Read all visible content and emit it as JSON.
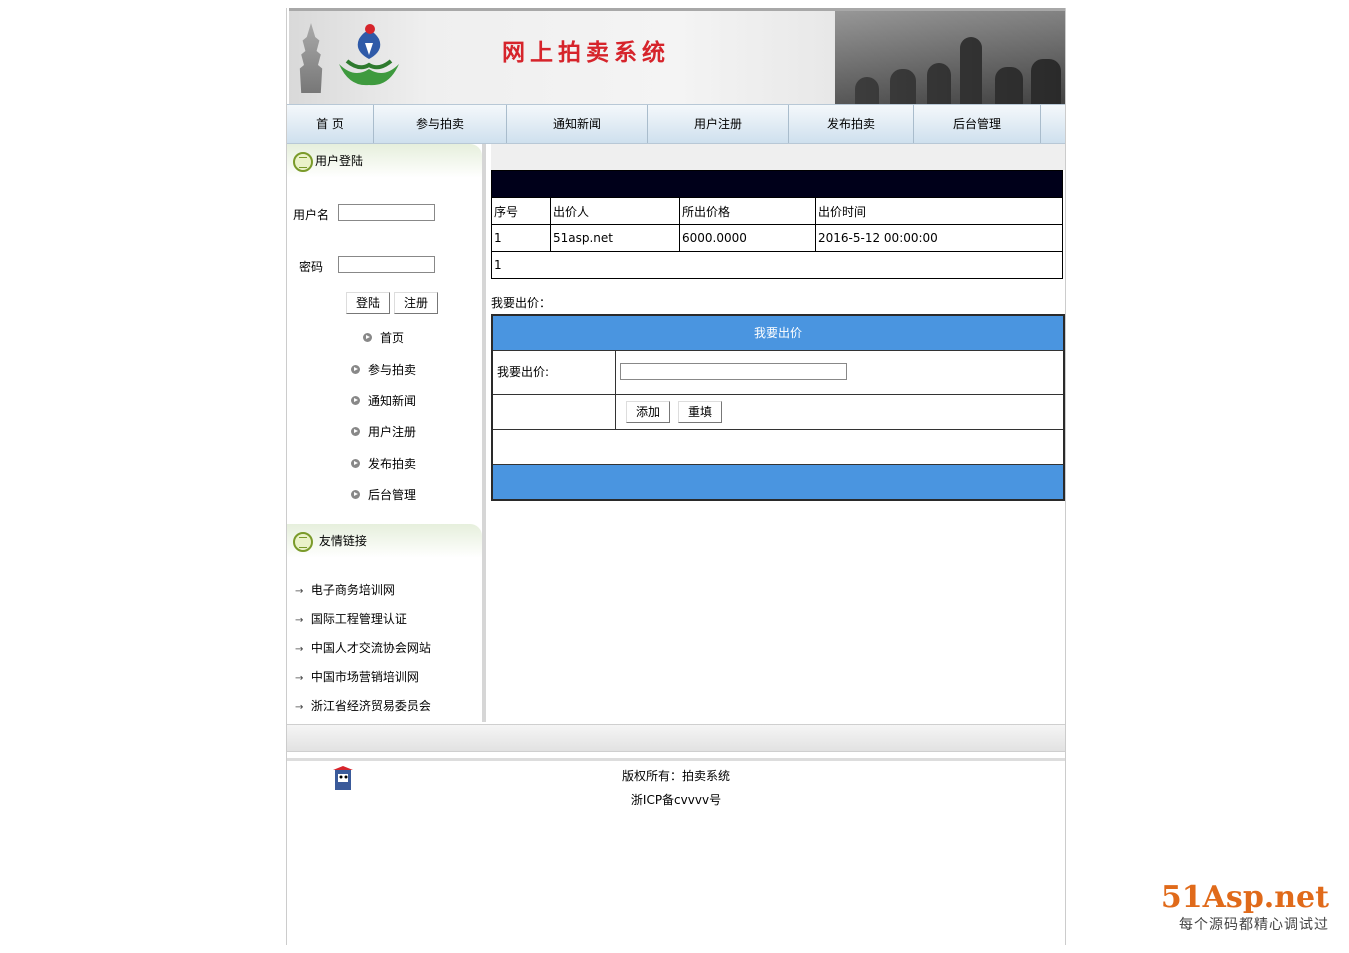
{
  "site_title": "网上拍卖系统",
  "nav": [
    "首 页",
    "参与拍卖",
    "通知新闻",
    "用户注册",
    "发布拍卖",
    "后台管理"
  ],
  "login": {
    "heading": "用户登陆",
    "username_label": "用户名",
    "password_label": "密码",
    "login_button": "登陆",
    "register_button": "注册"
  },
  "side_menu": [
    "首页",
    "参与拍卖",
    "通知新闻",
    "用户注册",
    "发布拍卖",
    "后台管理"
  ],
  "links": {
    "heading": "友情链接",
    "items": [
      "电子商务培训网",
      "国际工程管理认证",
      "中国人才交流协会网站",
      "中国市场营销培训网",
      "浙江省经济贸易委员会"
    ]
  },
  "bids": {
    "columns": [
      "序号",
      "出价人",
      "所出价格",
      "出价时间"
    ],
    "rows": [
      [
        "1",
        "51asp.net",
        "6000.0000",
        "2016-5-12 00:00:00"
      ]
    ],
    "pager": "1"
  },
  "bid_form": {
    "section_label": "我要出价：",
    "header": "我要出价",
    "price_label": "我要出价:",
    "price_value": "",
    "add_button": "添加",
    "reset_button": "重填"
  },
  "footer": {
    "copyright": "版权所有：拍卖系统",
    "icp": "浙ICP备cvvvv号"
  },
  "watermark": {
    "brand": "51Asp.net",
    "slogan": "每个源码都精心调试过"
  },
  "colors": {
    "title_red": "#d6242b",
    "form_blue": "#4a95e0",
    "brand_orange": "#e06a1a",
    "brand_green": "#4c9a2a"
  }
}
